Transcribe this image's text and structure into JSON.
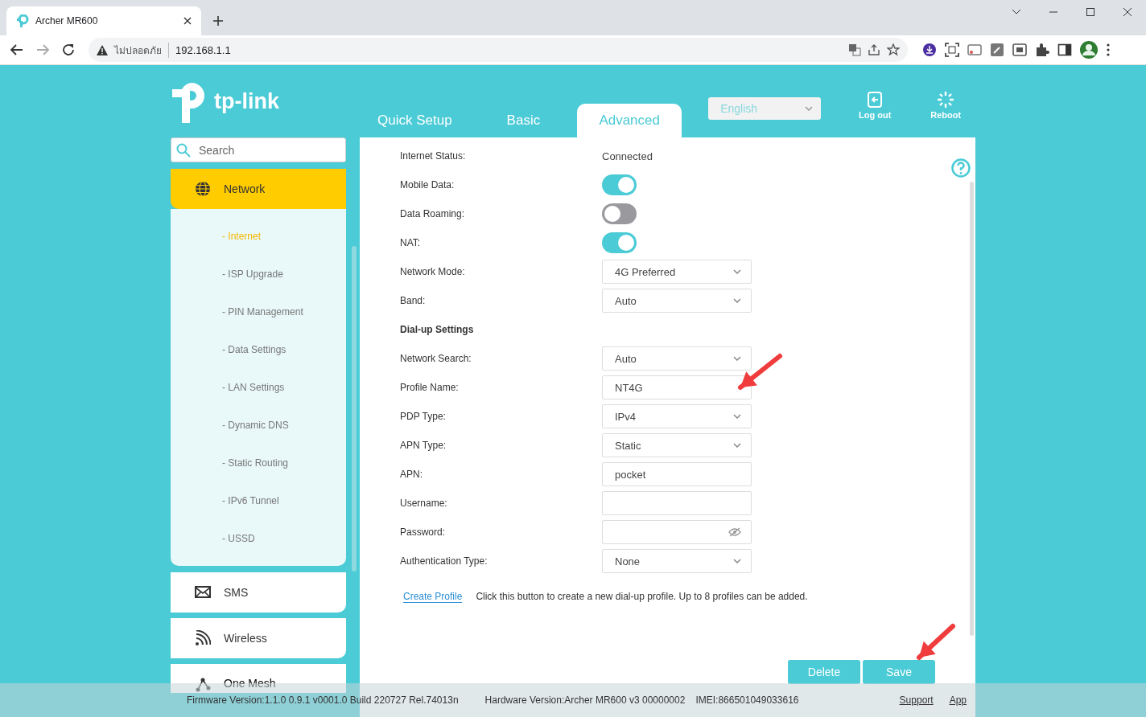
{
  "browser": {
    "tab_title": "Archer MR600",
    "security_label": "ไม่ปลอดภัย",
    "url": "192.168.1.1"
  },
  "header": {
    "brand": "tp-link",
    "tabs": [
      {
        "label": "Quick Setup",
        "selected": false
      },
      {
        "label": "Basic",
        "selected": false
      },
      {
        "label": "Advanced",
        "selected": true
      }
    ],
    "language": "English",
    "actions": [
      {
        "kind": "logout",
        "label": "Log out"
      },
      {
        "kind": "reboot",
        "label": "Reboot"
      }
    ]
  },
  "sidebar": {
    "search": {
      "placeholder": "Search"
    },
    "menu": [
      {
        "kind": "globe",
        "label": "Network",
        "selected": true,
        "expanded": true,
        "children": [
          {
            "label": "- Internet",
            "selected": true
          },
          {
            "label": "- ISP Upgrade",
            "selected": false
          },
          {
            "label": "- PIN Management",
            "selected": false
          },
          {
            "label": "- Data Settings",
            "selected": false
          },
          {
            "label": "- LAN Settings",
            "selected": false
          },
          {
            "label": "- Dynamic DNS",
            "selected": false
          },
          {
            "label": "- Static Routing",
            "selected": false
          },
          {
            "label": "- IPv6 Tunnel",
            "selected": false
          },
          {
            "label": "- USSD",
            "selected": false
          }
        ]
      },
      {
        "kind": "mail",
        "label": "SMS",
        "selected": false,
        "expanded": false
      },
      {
        "kind": "wifi",
        "label": "Wireless",
        "selected": false,
        "expanded": false
      },
      {
        "kind": "mesh",
        "label": "One Mesh",
        "selected": false,
        "expanded": false
      }
    ]
  },
  "form": {
    "rows": [
      {
        "kind": "text",
        "label": "Internet Status:",
        "value": "Connected"
      },
      {
        "kind": "toggle",
        "label": "Mobile Data:",
        "on": true
      },
      {
        "kind": "toggle",
        "label": "Data Roaming:",
        "on": false
      },
      {
        "kind": "toggle",
        "label": "NAT:",
        "on": true
      },
      {
        "kind": "select",
        "label": "Network Mode:",
        "value": "4G Preferred"
      },
      {
        "kind": "select",
        "label": "Band:",
        "value": "Auto"
      },
      {
        "kind": "heading",
        "label": "Dial-up Settings"
      },
      {
        "kind": "select",
        "label": "Network Search:",
        "value": "Auto"
      },
      {
        "kind": "input",
        "label": "Profile Name:",
        "value": "NT4G"
      },
      {
        "kind": "select",
        "label": "PDP Type:",
        "value": "IPv4"
      },
      {
        "kind": "select",
        "label": "APN Type:",
        "value": "Static"
      },
      {
        "kind": "input",
        "label": "APN:",
        "value": "pocket"
      },
      {
        "kind": "input",
        "label": "Username:"
      },
      {
        "kind": "password",
        "label": "Password:"
      },
      {
        "kind": "select",
        "label": "Authentication Type:",
        "value": "None"
      }
    ],
    "create_profile": {
      "link": "Create Profile",
      "note": "Click this button to create a new dial-up profile. Up to 8 profiles can be added."
    },
    "buttons": [
      "Delete",
      "Save"
    ]
  },
  "footer": {
    "firmware": "Firmware Version:1.1.0 0.9.1 v0001.0 Build 220727 Rel.74013n",
    "hardware": "Hardware Version:Archer MR600 v3 00000002",
    "imei": "IMEI:866501049033616",
    "links": [
      "Support",
      "App"
    ]
  }
}
